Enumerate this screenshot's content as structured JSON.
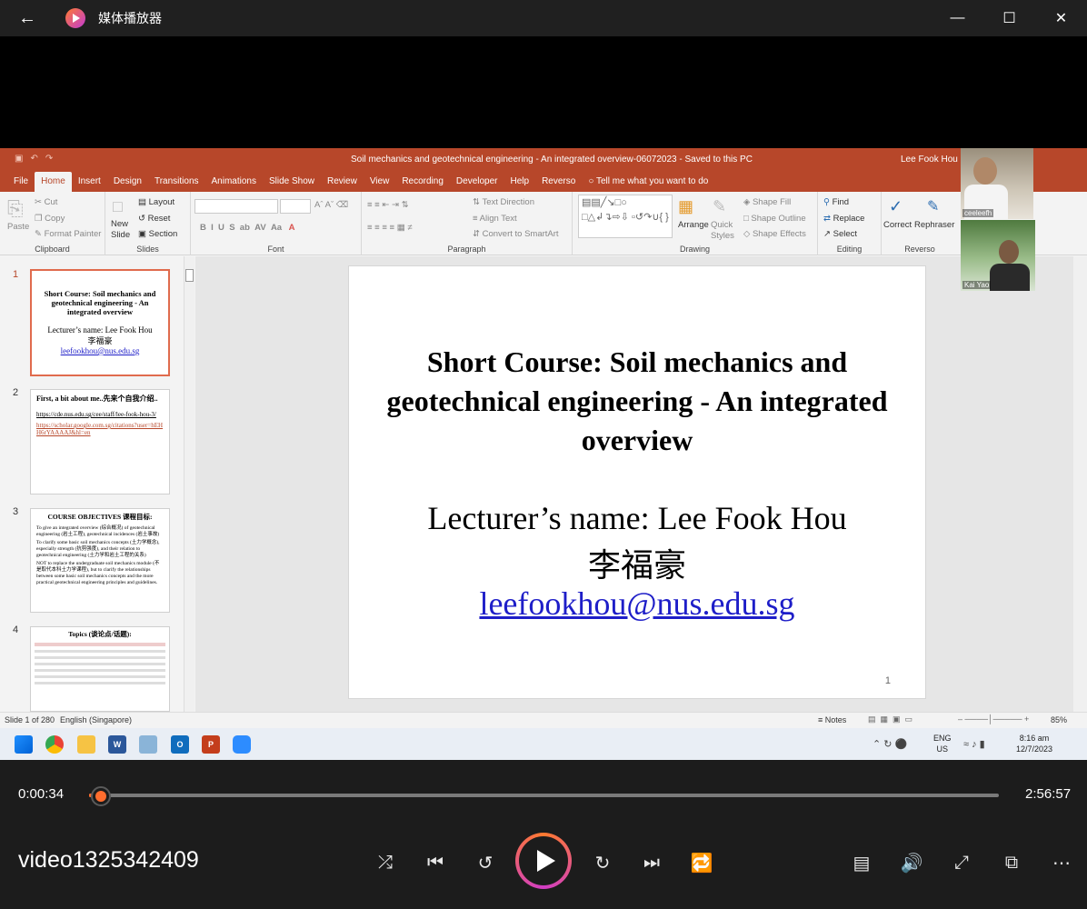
{
  "app": {
    "title": "媒体播放器"
  },
  "ppt": {
    "qat_icons": [
      "save-icon",
      "undo-icon",
      "redo-icon"
    ],
    "doc_title": "Soil mechanics and geotechnical engineering - An integrated overview-06072023  -  Saved to this PC",
    "user": "Lee Fook Hou",
    "tabs": [
      "File",
      "Home",
      "Insert",
      "Design",
      "Transitions",
      "Animations",
      "Slide Show",
      "Review",
      "View",
      "Recording",
      "Developer",
      "Help",
      "Reverso"
    ],
    "tell_me": "Tell me what you want to do",
    "ribbon": {
      "clipboard": {
        "label": "Clipboard",
        "paste": "Paste",
        "cut": "Cut",
        "copy": "Copy",
        "format_painter": "Format Painter"
      },
      "slides": {
        "label": "Slides",
        "new_slide": "New Slide",
        "layout": "Layout",
        "reset": "Reset",
        "section": "Section"
      },
      "font": {
        "label": "Font"
      },
      "paragraph": {
        "label": "Paragraph",
        "text_direction": "Text Direction",
        "align_text": "Align Text",
        "convert": "Convert to SmartArt"
      },
      "drawing": {
        "label": "Drawing",
        "arrange": "Arrange",
        "quick_styles": "Quick Styles",
        "shape_fill": "Shape Fill",
        "shape_outline": "Shape Outline",
        "shape_effects": "Shape Effects"
      },
      "editing": {
        "label": "Editing",
        "find": "Find",
        "replace": "Replace",
        "select": "Select"
      },
      "reverso": {
        "label": "Reverso",
        "correct": "Correct",
        "rephraser": "Rephraser"
      }
    },
    "thumbnails": [
      {
        "num": "1",
        "title": "Short Course: Soil mechanics and geotechnical engineering - An integrated overview",
        "lecturer": "Lecturer’s name: Lee Fook Hou",
        "chinese": "李福豪",
        "email": "leefookhou@nus.edu.sg"
      },
      {
        "num": "2",
        "title": "First, a bit about me..先来个自我介绍..",
        "link1": "https://cde.nus.edu.sg/cee/staff/lee-fook-hou-3/",
        "link2": "https://scholar.google.com.sg/citations?user=hEHH6rYAAAAJ&hl=en"
      },
      {
        "num": "3",
        "title": "COURSE OBJECTIVES 课程目标:",
        "b1": "To give an integrated overview (综合概况) of geotechnical engineering (岩土工程), geotechnical incidences (岩土事故)",
        "b2": "To clarify some basic soil mechanics concepts (土力学概念), especially strength (抗剪强度), and their relation to geotechnical engineering (土力学和岩土工程的关系)",
        "b3": "NOT to replace the undergraduate soil mechanics module (不是取代本科土力学课程), but to clarify the relationships between some basic soil mechanics concepts and the more practical geotechnical engineering principles and guidelines."
      },
      {
        "num": "4",
        "title": "Topics (谈论点/话题):"
      }
    ],
    "slide": {
      "title": "Short Course: Soil mechanics and geotechnical engineering - An integrated overview",
      "lecturer": "Lecturer’s name: Lee Fook Hou",
      "chinese": "李福豪",
      "email": "leefookhou@nus.edu.sg",
      "page": "1"
    },
    "status": {
      "slide_info": "Slide 1 of 280",
      "language": "English (Singapore)",
      "notes": "Notes",
      "zoom": "85%"
    }
  },
  "participants": [
    {
      "name": "ceeleefh"
    },
    {
      "name": "Kai Yao"
    }
  ],
  "taskbar": {
    "lang": "ENG",
    "region": "US",
    "time": "8:16 am",
    "date": "12/7/2023",
    "apps": [
      "windows-start",
      "chrome",
      "file-explorer",
      "word",
      "photos",
      "outlook",
      "powerpoint",
      "zoom"
    ]
  },
  "player": {
    "current_time": "0:00:34",
    "total_time": "2:56:57",
    "video_name": "video1325342409",
    "progress": 0.0032
  }
}
